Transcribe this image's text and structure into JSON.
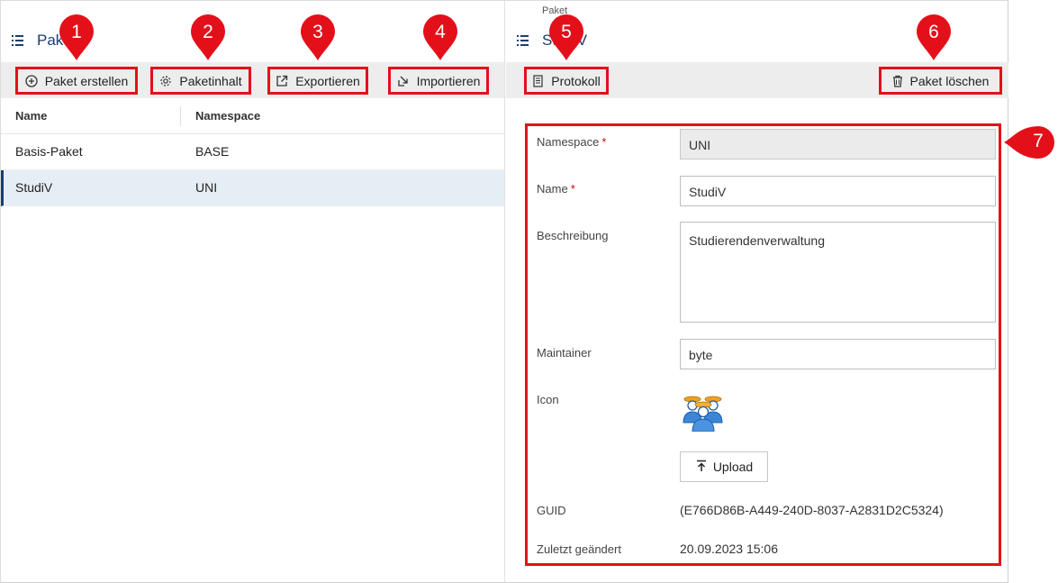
{
  "left_panel": {
    "title": "Pakete",
    "toolbar": {
      "create_label": "Paket erstellen",
      "content_label": "Paketinhalt",
      "export_label": "Exportieren",
      "import_label": "Importieren"
    },
    "columns": [
      "Name",
      "Namespace"
    ],
    "rows": [
      {
        "name": "Basis-Paket",
        "namespace": "BASE"
      },
      {
        "name": "StudiV",
        "namespace": "UNI"
      }
    ]
  },
  "right_panel": {
    "breadcrumb": "Paket",
    "title": "StudiV",
    "toolbar": {
      "log_label": "Protokoll",
      "delete_label": "Paket löschen"
    },
    "form": {
      "namespace_label": "Namespace",
      "namespace_value": "UNI",
      "name_label": "Name",
      "name_value": "StudiV",
      "description_label": "Beschreibung",
      "description_value": "Studierendenverwaltung",
      "maintainer_label": "Maintainer",
      "maintainer_value": "byte",
      "icon_label": "Icon",
      "upload_label": "Upload",
      "guid_label": "GUID",
      "guid_value": "(E766D86B-A449-240D-8037-A2831D2C5324)",
      "changed_label": "Zuletzt geändert",
      "changed_value": "20.09.2023 15:06",
      "required_mark": "*"
    }
  },
  "callouts": [
    "1",
    "2",
    "3",
    "4",
    "5",
    "6",
    "7"
  ],
  "colors": {
    "accent": "#1a3d6e",
    "callout": "#e3101a",
    "toolbar_bg": "#ededed",
    "selected_row": "#e5eef5"
  }
}
